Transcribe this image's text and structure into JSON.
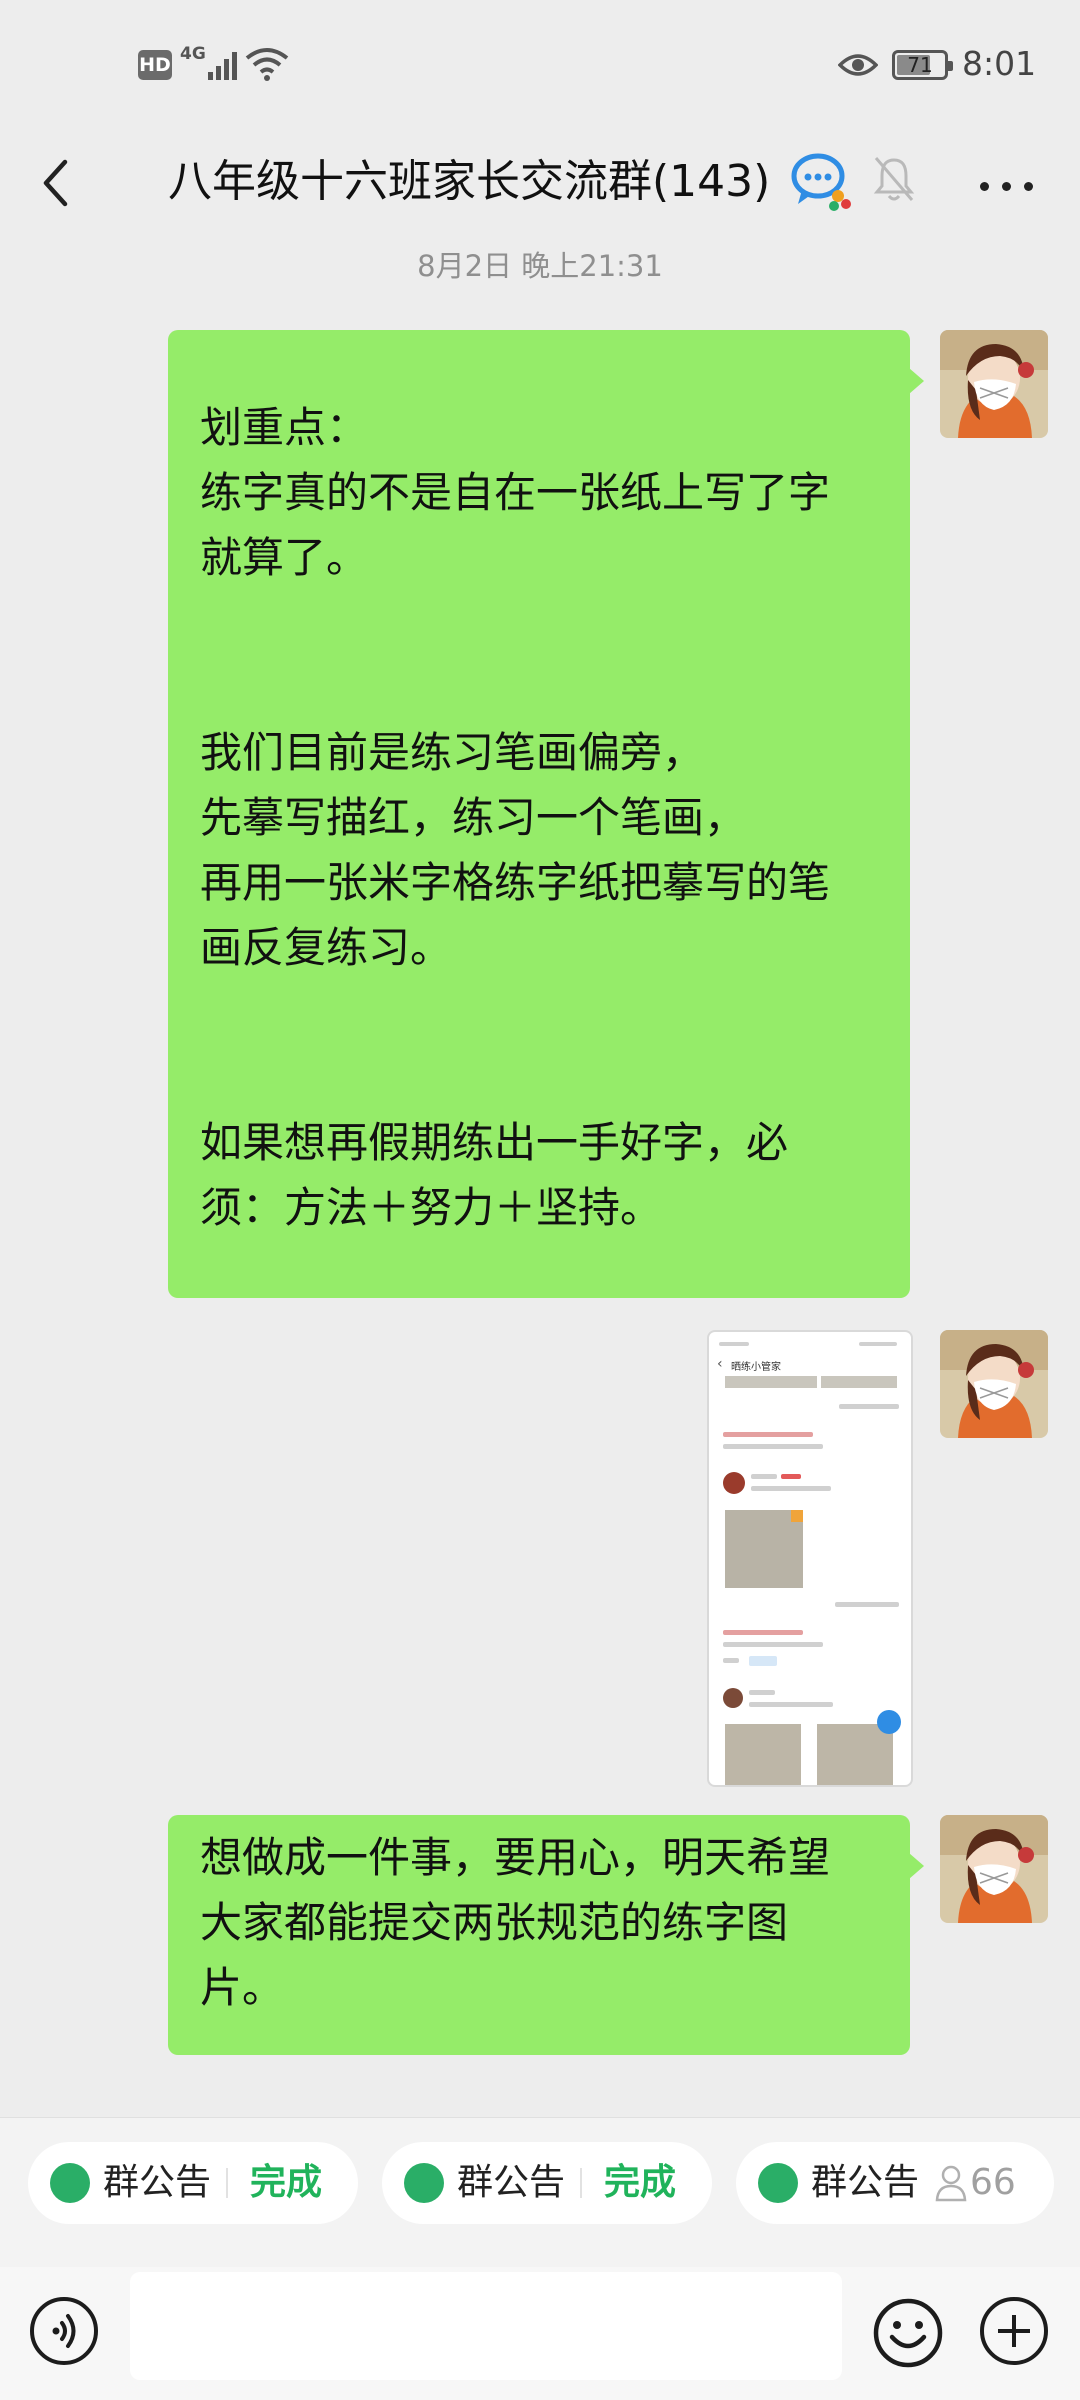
{
  "status_bar": {
    "hd": "HD",
    "network": "4G",
    "battery": "71",
    "battery_level": 0.71,
    "time": "8:01"
  },
  "nav": {
    "title": "八年级十六班家长交流群(143)",
    "icons": [
      "back-chevron-icon",
      "group-chat-icon",
      "mute-bell-icon",
      "more-icon"
    ]
  },
  "chat": {
    "timestamp": "8月2日 晚上21:31",
    "messages": [
      {
        "type": "text",
        "text": "\n划重点：\n练字真的不是自在一张纸上写了字\n就算了。\n\n\n我们目前是练习笔画偏旁，\n先摹写描红，练习一个笔画，\n再用一张米字格练字纸把摹写的笔\n画反复练习。\n\n\n如果想再假期练出一手好字，必\n须：方法＋努力＋坚持。"
      },
      {
        "type": "image",
        "caption": "晒练小管家"
      },
      {
        "type": "text",
        "text": "想做成一件事，要用心，明天希望\n大家都能提交两张规范的练字图\n片。"
      }
    ]
  },
  "announcements": [
    {
      "label": "群公告",
      "status": "完成"
    },
    {
      "label": "群公告",
      "status": "完成"
    },
    {
      "label": "群公告",
      "count": "66"
    }
  ],
  "colors": {
    "bubble": "#95ec69",
    "background": "#ededed",
    "accent": "#20b35b"
  }
}
